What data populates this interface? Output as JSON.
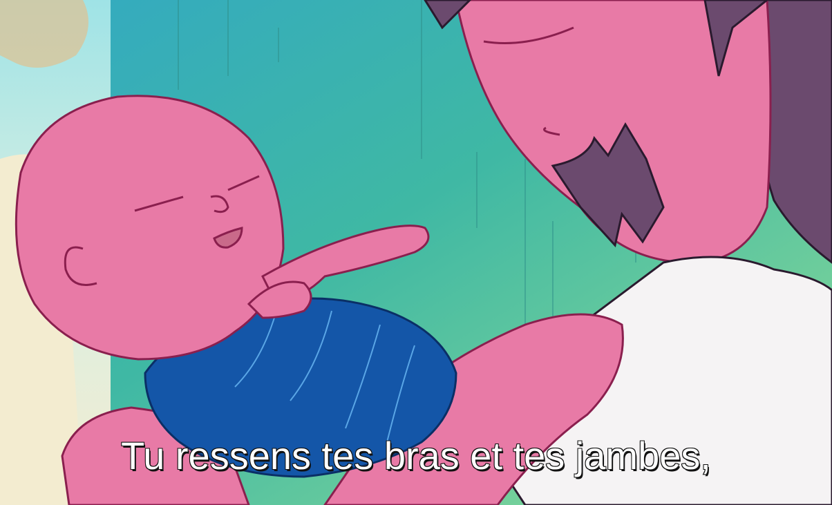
{
  "subtitle": {
    "text": "Tu ressens tes bras et tes jambes,"
  },
  "colors": {
    "background_teal": "#3fb8a4",
    "background_green": "#7fd39a",
    "skin_pink": "#e87aa6",
    "outline": "#8a1f4e",
    "hair_purple": "#6b4a6e",
    "blanket_blue": "#1456a8",
    "shirt_white": "#f5f3f4",
    "pillow_cream": "#f3ecd0",
    "subtitle_text": "#ffffff"
  }
}
